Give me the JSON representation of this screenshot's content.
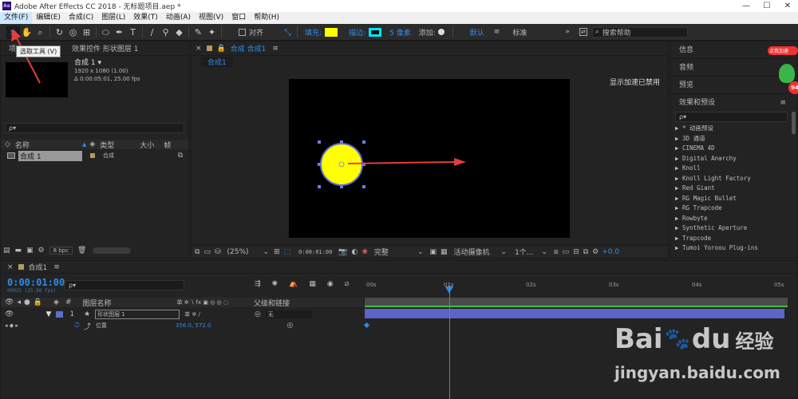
{
  "titlebar": {
    "app_icon": "Ae",
    "title": "Adobe After Effects CC 2018 - 无标题项目.aep *",
    "minimize": "—",
    "maximize": "☐",
    "close": "✕"
  },
  "menu": [
    "文件(F)",
    "编辑(E)",
    "合成(C)",
    "图层(L)",
    "效果(T)",
    "动画(A)",
    "视图(V)",
    "窗口",
    "帮助(H)"
  ],
  "toolbar": {
    "snap_label": "对齐",
    "fill_label": "填充:",
    "fill_color": "#ffff00",
    "stroke_label": "描边:",
    "stroke_color": "#00e5ff",
    "stroke_width": "5 像素",
    "add_label": "添加:",
    "workspace_default": "默认",
    "workspace_standard": "标准",
    "search_help_placeholder": "搜索帮助",
    "tooltip": "选取工具 (V)"
  },
  "project": {
    "tab_short": "项",
    "tab_effects": "效果控件 形状图层 1",
    "comp_name": "合成 1 ▾",
    "comp_size": "1920 x 1080 (1.00)",
    "comp_duration": "Δ 0:00:05:01, 25.00 fps",
    "search_placeholder": "ρ▾",
    "col_name": "名称",
    "col_type": "类型",
    "col_size": "大小",
    "col_extra": "帧",
    "row_name": "合成 1",
    "row_type": "合成",
    "bpc": "8 bpc"
  },
  "composition": {
    "tab_label": "合成 合成1",
    "subtab": "合成1",
    "gpu_notice": "显示加速已禁用",
    "shape_fill": "#ffff00",
    "zoom": "(25%)",
    "timecode": "0:00:01:00",
    "resolution": "完整",
    "camera": "活动摄像机",
    "views": "1个...",
    "exposure": "+0.0"
  },
  "right_panels": {
    "info": "信息",
    "audio": "音频",
    "preview": "预览",
    "effects_presets": "效果和预设",
    "search_placeholder": "ρ▾",
    "effects": [
      "▶ * 动画预设",
      "▶ 3D 通道",
      "▶ CINEMA 4D",
      "▶ Digital Anarchy",
      "▶ Knoll",
      "▶ Knoll Light Factory",
      "▶ Red Giant",
      "▶ RG Magic Bullet",
      "▶ RG Trapcode",
      "▶ Rowbyte",
      "▶ Synthetic Aperture",
      "▶ Trapcode",
      "▶ Tumoi Yoroou Plug-ins"
    ]
  },
  "badge": {
    "text": "点我加速",
    "number": "94"
  },
  "timeline": {
    "tab_label": "合成1",
    "timecode": "0:00:01:00",
    "frame_info": "00025 (25.00 fps)",
    "search_placeholder": "ρ▾",
    "col_layer_name": "图层名称",
    "col_switches": "单 ✲ ∖ fx ▣ ◎ ◎ ◌",
    "col_parent": "父级和链接",
    "layer_num": "1",
    "layer_name": "形状图层 1",
    "layer_parent": "无",
    "prop_name": "位置",
    "prop_value": "356.0, 572.0",
    "ticks": [
      "00s",
      "01s",
      "02s",
      "03s",
      "04s",
      "05s"
    ]
  },
  "watermark": {
    "brand": "Bai",
    "brand2": "du",
    "sub": "经验",
    "url": "jingyan.baidu.com"
  }
}
